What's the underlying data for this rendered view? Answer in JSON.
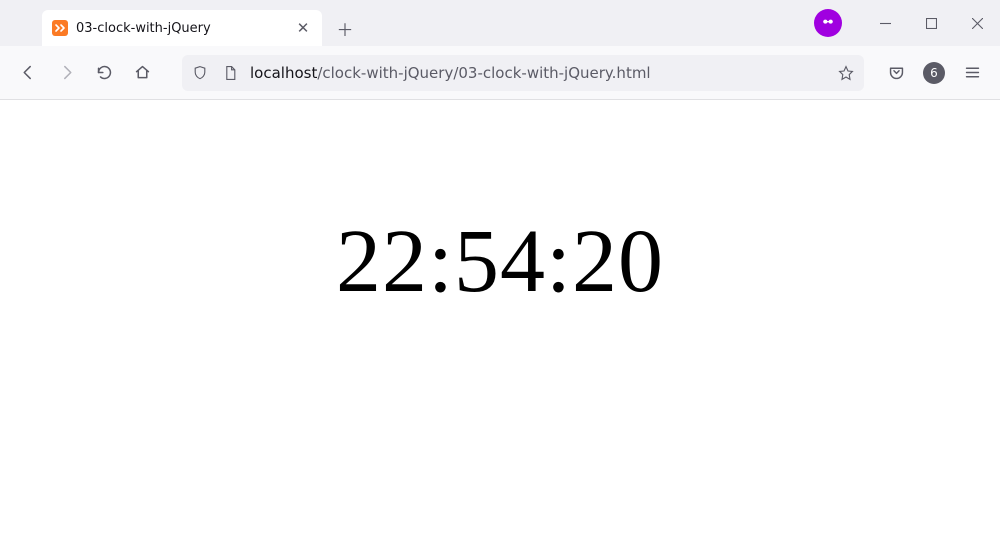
{
  "tab": {
    "title": "03-clock-with-jQuery"
  },
  "url": {
    "host": "localhost",
    "path": "/clock-with-jQuery/03-clock-with-jQuery.html"
  },
  "toolbar": {
    "badge_count": "6"
  },
  "page": {
    "clock_time": "22:54:20"
  }
}
